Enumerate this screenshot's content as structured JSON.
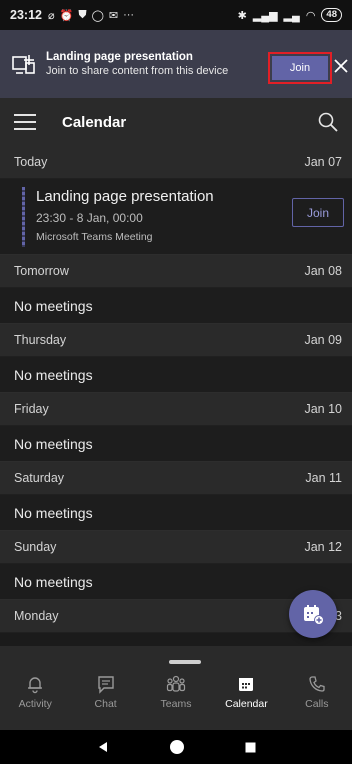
{
  "status_bar": {
    "time": "23:12",
    "notification_icons": [
      "no-disturb-icon",
      "alarm-icon",
      "shield-icon",
      "whatsapp-icon",
      "mail-icon",
      "more-icon"
    ],
    "more": "···",
    "battery": "48"
  },
  "banner": {
    "title": "Landing page presentation",
    "subtitle": "Join to share content from this device",
    "join_label": "Join",
    "highlight_color": "#e21f26"
  },
  "header": {
    "title": "Calendar"
  },
  "agenda": {
    "today": {
      "label": "Today",
      "date": "Jan 07"
    },
    "meeting": {
      "title": "Landing page presentation",
      "time": "23:30 - 8 Jan, 00:00",
      "type": "Microsoft Teams Meeting",
      "join_label": "Join"
    },
    "days": [
      {
        "label": "Tomorrow",
        "date": "Jan 08",
        "empty": "No meetings"
      },
      {
        "label": "Thursday",
        "date": "Jan 09",
        "empty": "No meetings"
      },
      {
        "label": "Friday",
        "date": "Jan 10",
        "empty": "No meetings"
      },
      {
        "label": "Saturday",
        "date": "Jan 11",
        "empty": "No meetings"
      },
      {
        "label": "Sunday",
        "date": "Jan 12",
        "empty": "No meetings"
      }
    ],
    "last_day": {
      "label": "Monday",
      "date": "13"
    }
  },
  "nav": {
    "items": [
      {
        "label": "Activity",
        "icon": "bell-icon"
      },
      {
        "label": "Chat",
        "icon": "chat-icon"
      },
      {
        "label": "Teams",
        "icon": "teams-icon"
      },
      {
        "label": "Calendar",
        "icon": "calendar-icon",
        "active": true
      },
      {
        "label": "Calls",
        "icon": "phone-icon"
      }
    ]
  },
  "colors": {
    "accent": "#6264a7",
    "background": "#1b1b1b"
  }
}
